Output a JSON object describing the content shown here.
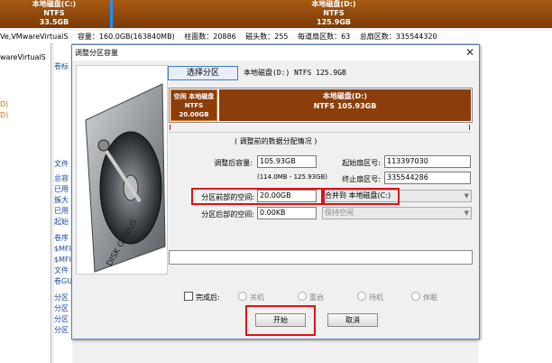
{
  "background": {
    "partition_bar": {
      "left_label": "本地磁盘(C:)",
      "left_fs": "NTFS",
      "left_size": "33.5GB",
      "right_label": "本地磁盘(D:)",
      "right_fs": "NTFS",
      "right_size": "125.9GB"
    },
    "info_bar": {
      "disk": "Ve,VMwareVirtualS",
      "capacity": "容量：160.0GB(163840MB)",
      "cylinders": "柱面数：20886",
      "heads": "磁头数：255",
      "sectors_per_track": "每道扇区数：63",
      "total_sectors": "总扇区数：335544320"
    },
    "left_panel": [
      "wareVirtualS",
      "",
      "D)",
      "D)"
    ],
    "mid_panel": [
      "卷标",
      "",
      "",
      "",
      "",
      "",
      "",
      "",
      "",
      "文件",
      "",
      "总容",
      "已用",
      "簇大",
      "已用",
      "起始",
      "",
      "卷序",
      "$MFI",
      "$MFI",
      "文件",
      "卷GU",
      "",
      "分区",
      "分区",
      "分区",
      "分区"
    ]
  },
  "dialog": {
    "title": "调整分区容量",
    "close": "✕",
    "select_partition_button": "选择分区",
    "selected_partition_text": "本地磁盘(D:) NTFS 125.9GB",
    "partition_map": {
      "new_label": "空闲",
      "new_target": "本地磁盘",
      "new_fs": "NTFS",
      "new_size": "20.00GB",
      "main_label": "本地磁盘(D:)",
      "main_fs": "NTFS",
      "main_size": "105.93GB"
    },
    "section_title": "( 调整前的数据分配情况 )",
    "size_after_label": "调整后容量:",
    "size_after_value": "105.93GB",
    "size_hint": "(114.0MB - 125.93GB)",
    "start_sector_label": "起始扇区号:",
    "start_sector_value": "113397030",
    "end_sector_label": "终止扇区号:",
    "end_sector_value": "335544286",
    "space_before_label": "分区前部的空间:",
    "space_before_value": "20.00GB",
    "space_before_action": "合并到 本地磁盘(C:)",
    "space_after_label": "分区后部的空间:",
    "space_after_value": "0.00KB",
    "space_after_action": "保持空闲",
    "after_complete_label": "完成后:",
    "radio_options": [
      "关机",
      "重启",
      "待机",
      "休眠"
    ],
    "start_button": "开始",
    "cancel_button": "取消",
    "hdd_art_text": "DISK GENIUS"
  }
}
